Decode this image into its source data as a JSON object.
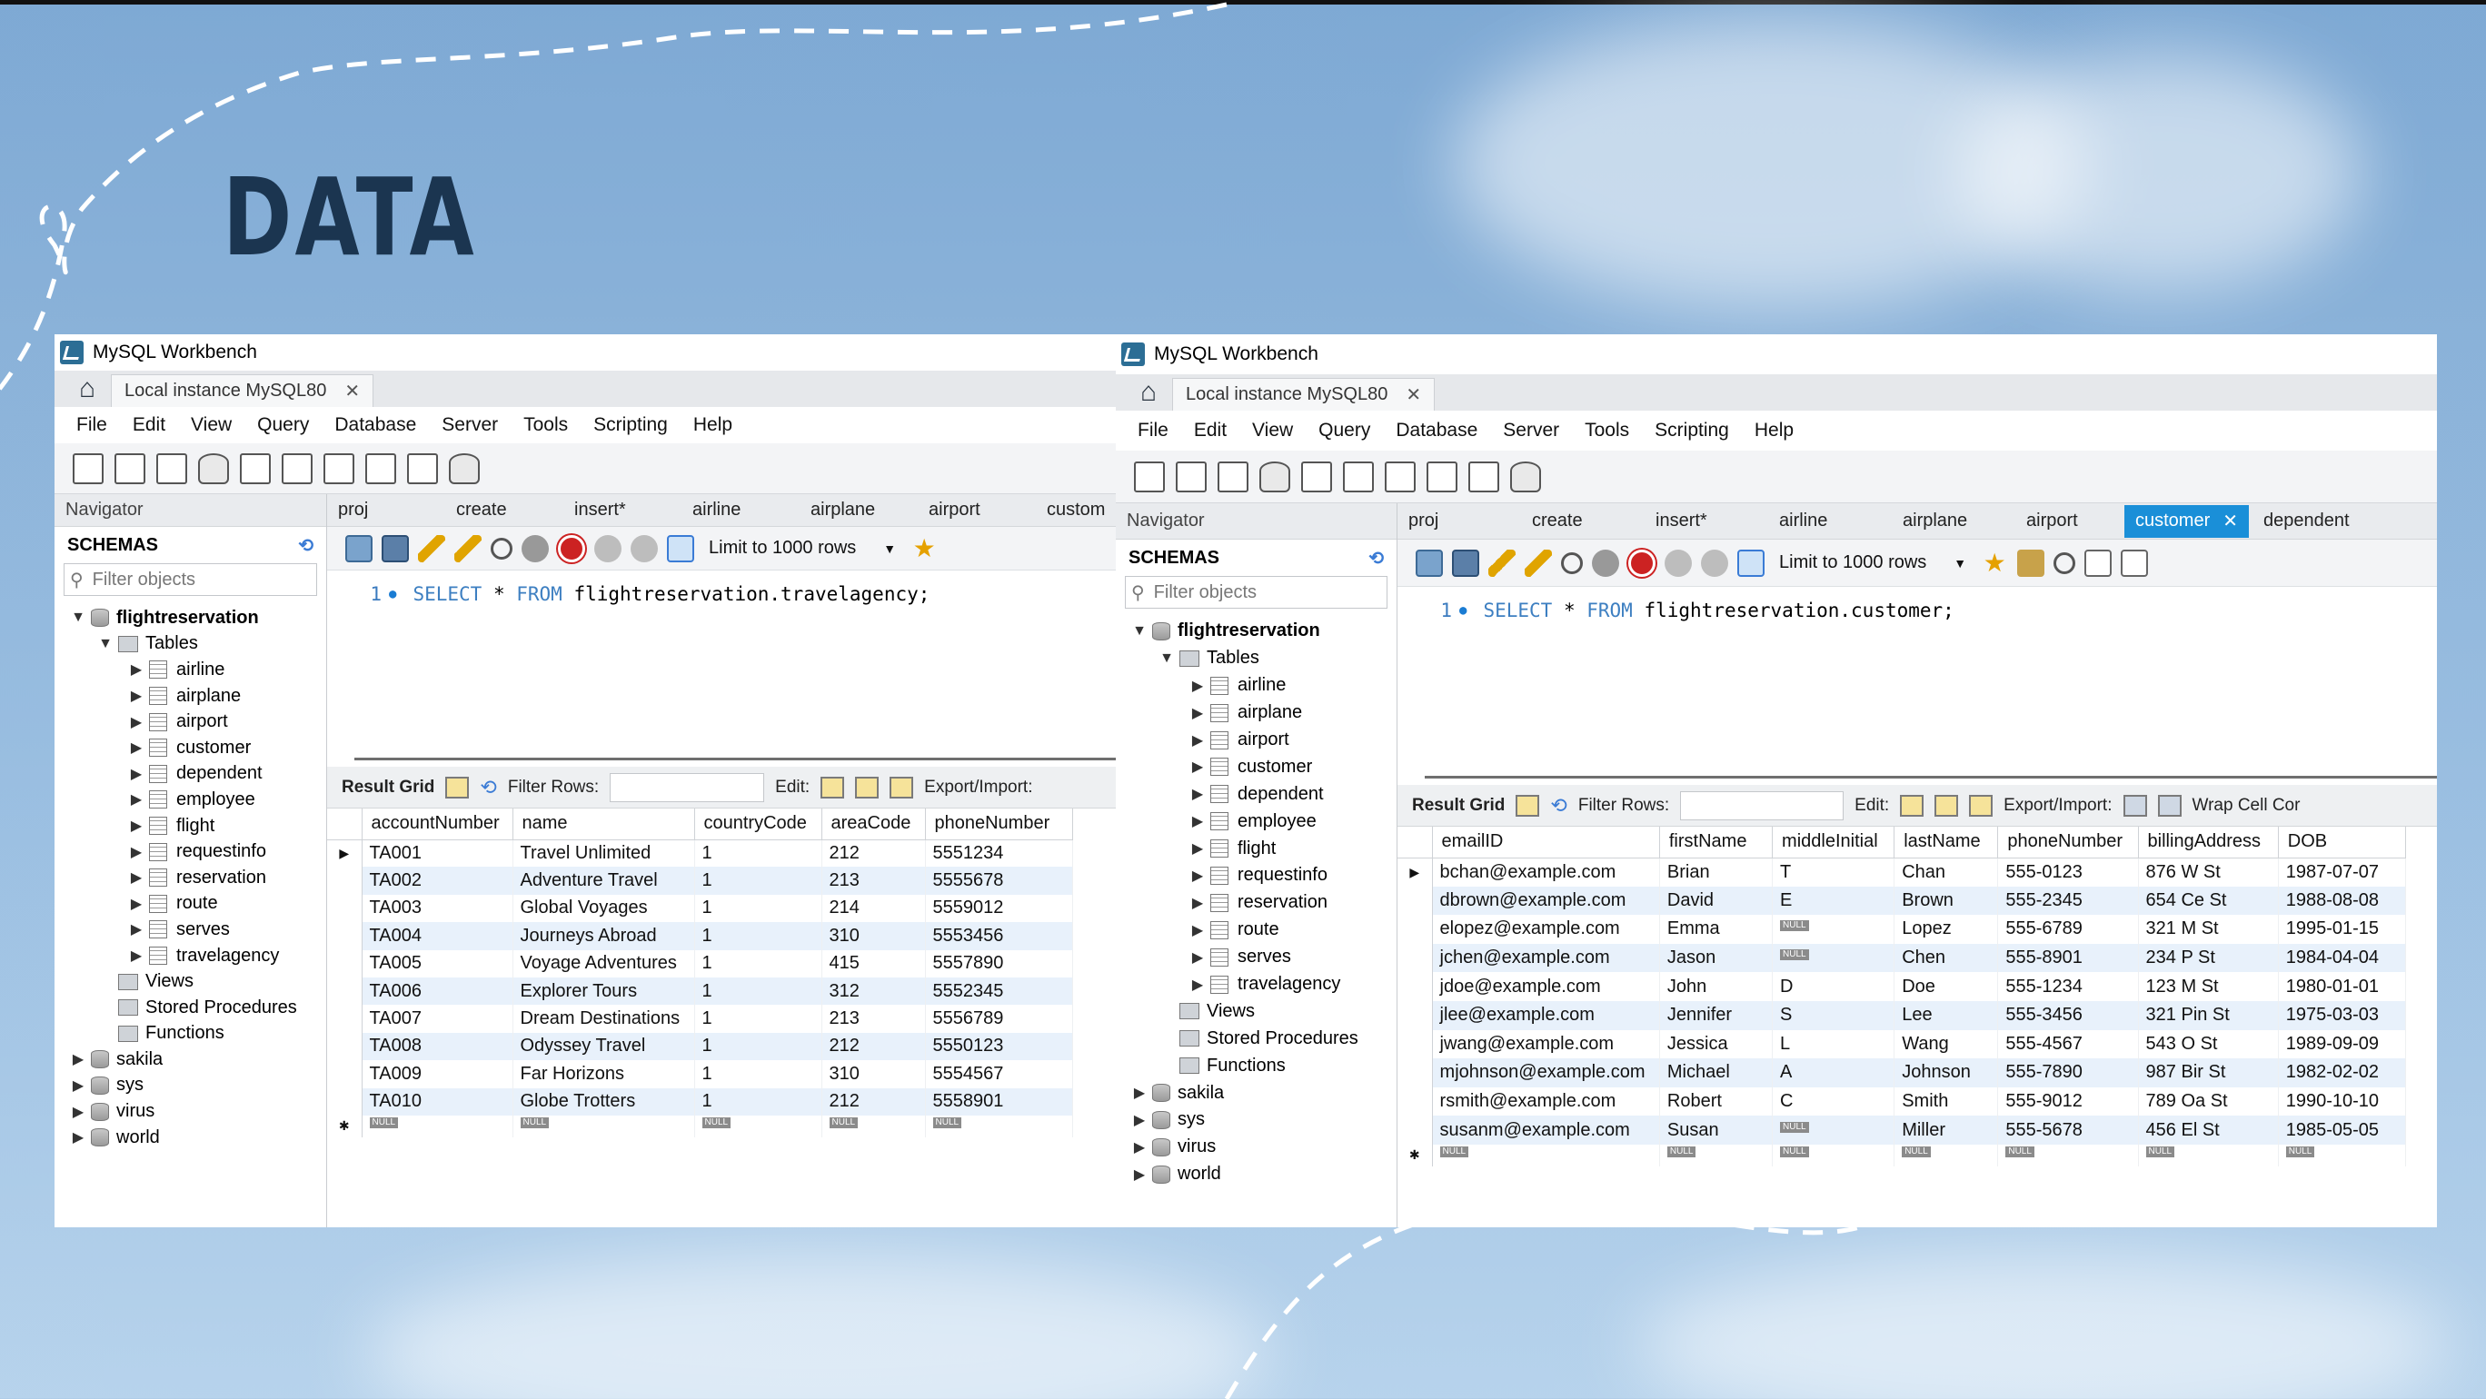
{
  "slide": {
    "title": "DATA"
  },
  "left": {
    "app_title": "MySQL Workbench",
    "conn_tab": "Local instance MySQL80",
    "menu": [
      "File",
      "Edit",
      "View",
      "Query",
      "Database",
      "Server",
      "Tools",
      "Scripting",
      "Help"
    ],
    "navigator_label": "Navigator",
    "schemas_label": "SCHEMAS",
    "filter_placeholder": "Filter objects",
    "tree": {
      "schema": "flightreservation",
      "tables_label": "Tables",
      "tables": [
        "airline",
        "airplane",
        "airport",
        "customer",
        "dependent",
        "employee",
        "flight",
        "requestinfo",
        "reservation",
        "route",
        "serves",
        "travelagency"
      ],
      "views": "Views",
      "procs": "Stored Procedures",
      "funcs": "Functions",
      "others": [
        "sakila",
        "sys",
        "virus",
        "world"
      ]
    },
    "query_tabs": [
      "proj",
      "create",
      "insert*",
      "airline",
      "airplane",
      "airport",
      "custom"
    ],
    "limit": "Limit to 1000 rows",
    "query": {
      "line": "1",
      "kw1": "SELECT",
      "mid": " * ",
      "kw2": "FROM",
      "rest": " flightreservation.travelagency;"
    },
    "result": {
      "grid_label": "Result Grid",
      "filter_label": "Filter Rows:",
      "edit_label": "Edit:",
      "export_label": "Export/Import:"
    },
    "columns": [
      "accountNumber",
      "name",
      "countryCode",
      "areaCode",
      "phoneNumber"
    ],
    "rows": [
      [
        "TA001",
        "Travel Unlimited",
        "1",
        "212",
        "5551234"
      ],
      [
        "TA002",
        "Adventure Travel",
        "1",
        "213",
        "5555678"
      ],
      [
        "TA003",
        "Global Voyages",
        "1",
        "214",
        "5559012"
      ],
      [
        "TA004",
        "Journeys Abroad",
        "1",
        "310",
        "5553456"
      ],
      [
        "TA005",
        "Voyage Adventures",
        "1",
        "415",
        "5557890"
      ],
      [
        "TA006",
        "Explorer Tours",
        "1",
        "312",
        "5552345"
      ],
      [
        "TA007",
        "Dream Destinations",
        "1",
        "213",
        "5556789"
      ],
      [
        "TA008",
        "Odyssey Travel",
        "1",
        "212",
        "5550123"
      ],
      [
        "TA009",
        "Far Horizons",
        "1",
        "310",
        "5554567"
      ],
      [
        "TA010",
        "Globe Trotters",
        "1",
        "212",
        "5558901"
      ]
    ],
    "null_label": "NULL"
  },
  "right": {
    "app_title": "MySQL Workbench",
    "conn_tab": "Local instance MySQL80",
    "menu": [
      "File",
      "Edit",
      "View",
      "Query",
      "Database",
      "Server",
      "Tools",
      "Scripting",
      "Help"
    ],
    "navigator_label": "Navigator",
    "schemas_label": "SCHEMAS",
    "filter_placeholder": "Filter objects",
    "tree": {
      "schema": "flightreservation",
      "tables_label": "Tables",
      "tables": [
        "airline",
        "airplane",
        "airport",
        "customer",
        "dependent",
        "employee",
        "flight",
        "requestinfo",
        "reservation",
        "route",
        "serves",
        "travelagency"
      ],
      "views": "Views",
      "procs": "Stored Procedures",
      "funcs": "Functions",
      "others": [
        "sakila",
        "sys",
        "virus",
        "world"
      ]
    },
    "query_tabs": [
      "proj",
      "create",
      "insert*",
      "airline",
      "airplane",
      "airport",
      "customer",
      "dependent"
    ],
    "limit": "Limit to 1000 rows",
    "query": {
      "line": "1",
      "kw1": "SELECT",
      "mid": " * ",
      "kw2": "FROM",
      "rest": " flightreservation.customer;"
    },
    "result": {
      "grid_label": "Result Grid",
      "filter_label": "Filter Rows:",
      "edit_label": "Edit:",
      "export_label": "Export/Import:",
      "wrap_label": "Wrap Cell Cor"
    },
    "columns": [
      "emailID",
      "firstName",
      "middleInitial",
      "lastName",
      "phoneNumber",
      "billingAddress",
      "DOB"
    ],
    "rows": [
      [
        "bchan@example.com",
        "Brian",
        "T",
        "Chan",
        "555-0123",
        "876 W St",
        "1987-07-07"
      ],
      [
        "dbrown@example.com",
        "David",
        "E",
        "Brown",
        "555-2345",
        "654 Ce St",
        "1988-08-08"
      ],
      [
        "elopez@example.com",
        "Emma",
        "NULL",
        "Lopez",
        "555-6789",
        "321 M St",
        "1995-01-15"
      ],
      [
        "jchen@example.com",
        "Jason",
        "NULL",
        "Chen",
        "555-8901",
        "234 P St",
        "1984-04-04"
      ],
      [
        "jdoe@example.com",
        "John",
        "D",
        "Doe",
        "555-1234",
        "123 M St",
        "1980-01-01"
      ],
      [
        "jlee@example.com",
        "Jennifer",
        "S",
        "Lee",
        "555-3456",
        "321 Pin St",
        "1975-03-03"
      ],
      [
        "jwang@example.com",
        "Jessica",
        "L",
        "Wang",
        "555-4567",
        "543 O St",
        "1989-09-09"
      ],
      [
        "mjohnson@example.com",
        "Michael",
        "A",
        "Johnson",
        "555-7890",
        "987 Bir St",
        "1982-02-02"
      ],
      [
        "rsmith@example.com",
        "Robert",
        "C",
        "Smith",
        "555-9012",
        "789 Oa St",
        "1990-10-10"
      ],
      [
        "susanm@example.com",
        "Susan",
        "NULL",
        "Miller",
        "555-5678",
        "456 El St",
        "1985-05-05"
      ]
    ],
    "null_label": "NULL"
  },
  "icons": {
    "home": "home-icon",
    "close": "close-icon",
    "search": "search-icon",
    "refresh": "refresh-icon"
  }
}
